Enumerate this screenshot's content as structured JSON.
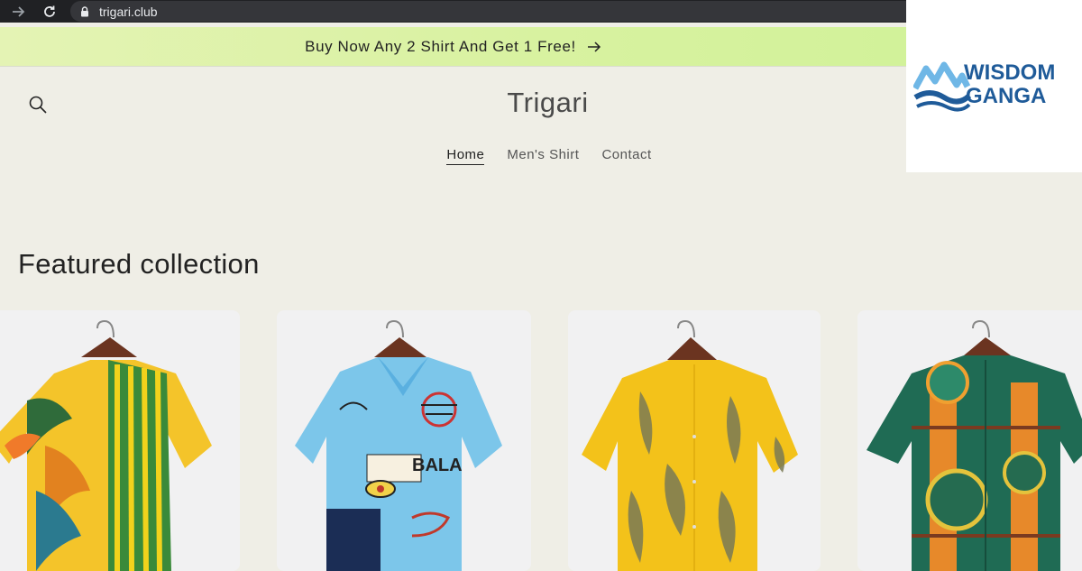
{
  "browser": {
    "url": "trigari.club",
    "icons": [
      "forward-arrow-icon",
      "reload-icon",
      "lock-icon"
    ]
  },
  "announcement": {
    "text": "Buy Now Any 2 Shirt And Get 1 Free!",
    "arrow_icon": "arrow-right-icon"
  },
  "header": {
    "site_title": "Trigari",
    "search_icon": "search-icon",
    "nav": [
      {
        "label": "Home",
        "active": true
      },
      {
        "label": "Men's Shirt",
        "active": false
      },
      {
        "label": "Contact",
        "active": false
      }
    ]
  },
  "watermark": {
    "line1": "WISDOM",
    "line2": "GANGA",
    "color": "#1f5b99"
  },
  "featured": {
    "title": "Featured collection",
    "products": [
      {
        "style": "tropical-striped-shirt"
      },
      {
        "style": "graffiti-print-shirt"
      },
      {
        "style": "yellow-fern-shirt"
      },
      {
        "style": "green-ethnic-print-shirt"
      }
    ]
  },
  "colors": {
    "page_bg": "#efeee6",
    "announcement_bg": "#dbf2a8",
    "text": "#222222"
  }
}
